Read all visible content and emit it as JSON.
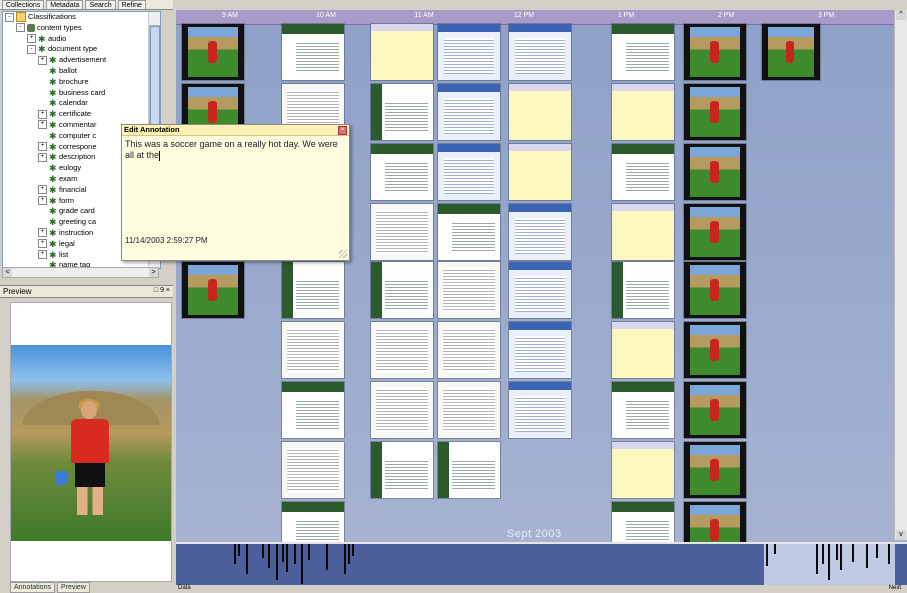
{
  "left_panel": {
    "tabs": [
      "Collections",
      "Metadata",
      "Search",
      "Refine"
    ],
    "tree": [
      {
        "label": "Classifications",
        "level": 0,
        "expander": "-",
        "icon": "folder"
      },
      {
        "label": "content types",
        "level": 1,
        "expander": "-",
        "icon": "content-type"
      },
      {
        "label": "audio",
        "level": 2,
        "expander": "+",
        "icon": "tag"
      },
      {
        "label": "document type",
        "level": 2,
        "expander": "-",
        "icon": "tag"
      },
      {
        "label": "advertisement",
        "level": 3,
        "expander": "+",
        "icon": "tag"
      },
      {
        "label": "ballot",
        "level": 3,
        "expander": "",
        "icon": "tag"
      },
      {
        "label": "brochure",
        "level": 3,
        "expander": "",
        "icon": "tag"
      },
      {
        "label": "business card",
        "level": 3,
        "expander": "",
        "icon": "tag"
      },
      {
        "label": "calendar",
        "level": 3,
        "expander": "",
        "icon": "tag"
      },
      {
        "label": "certificate",
        "level": 3,
        "expander": "+",
        "icon": "tag"
      },
      {
        "label": "commentar",
        "level": 3,
        "expander": "+",
        "icon": "tag"
      },
      {
        "label": "computer c",
        "level": 3,
        "expander": "",
        "icon": "tag"
      },
      {
        "label": "correspone",
        "level": 3,
        "expander": "+",
        "icon": "tag"
      },
      {
        "label": "description",
        "level": 3,
        "expander": "+",
        "icon": "tag"
      },
      {
        "label": "eulogy",
        "level": 3,
        "expander": "",
        "icon": "tag"
      },
      {
        "label": "exam",
        "level": 3,
        "expander": "",
        "icon": "tag"
      },
      {
        "label": "financial",
        "level": 3,
        "expander": "+",
        "icon": "tag"
      },
      {
        "label": "form",
        "level": 3,
        "expander": "+",
        "icon": "tag"
      },
      {
        "label": "grade card",
        "level": 3,
        "expander": "",
        "icon": "tag"
      },
      {
        "label": "greeting ca",
        "level": 3,
        "expander": "",
        "icon": "tag"
      },
      {
        "label": "instruction",
        "level": 3,
        "expander": "+",
        "icon": "tag"
      },
      {
        "label": "legal",
        "level": 3,
        "expander": "+",
        "icon": "tag"
      },
      {
        "label": "list",
        "level": 3,
        "expander": "+",
        "icon": "tag"
      },
      {
        "label": "name tag",
        "level": 3,
        "expander": "",
        "icon": "tag"
      }
    ],
    "preview_title": "Preview",
    "preview_controls": "□ 9 ×",
    "bottom_tabs": [
      "Annotations",
      "Preview"
    ]
  },
  "timeline": {
    "times": [
      "9 AM",
      "10 AM",
      "11 AM",
      "12 PM",
      "1 PM",
      "2 PM",
      "3 PM"
    ],
    "date_label": "Sept 2003",
    "colors": {
      "background": "#9aa9cd",
      "timebar": "#a79cc7"
    }
  },
  "annotation": {
    "title": "Edit Annotation",
    "text": "This was a soccer game on a really hot day. We were all at the",
    "timestamp": "11/14/2003 2:59:27 PM"
  },
  "status": {
    "left": "Data",
    "right": "Next"
  }
}
